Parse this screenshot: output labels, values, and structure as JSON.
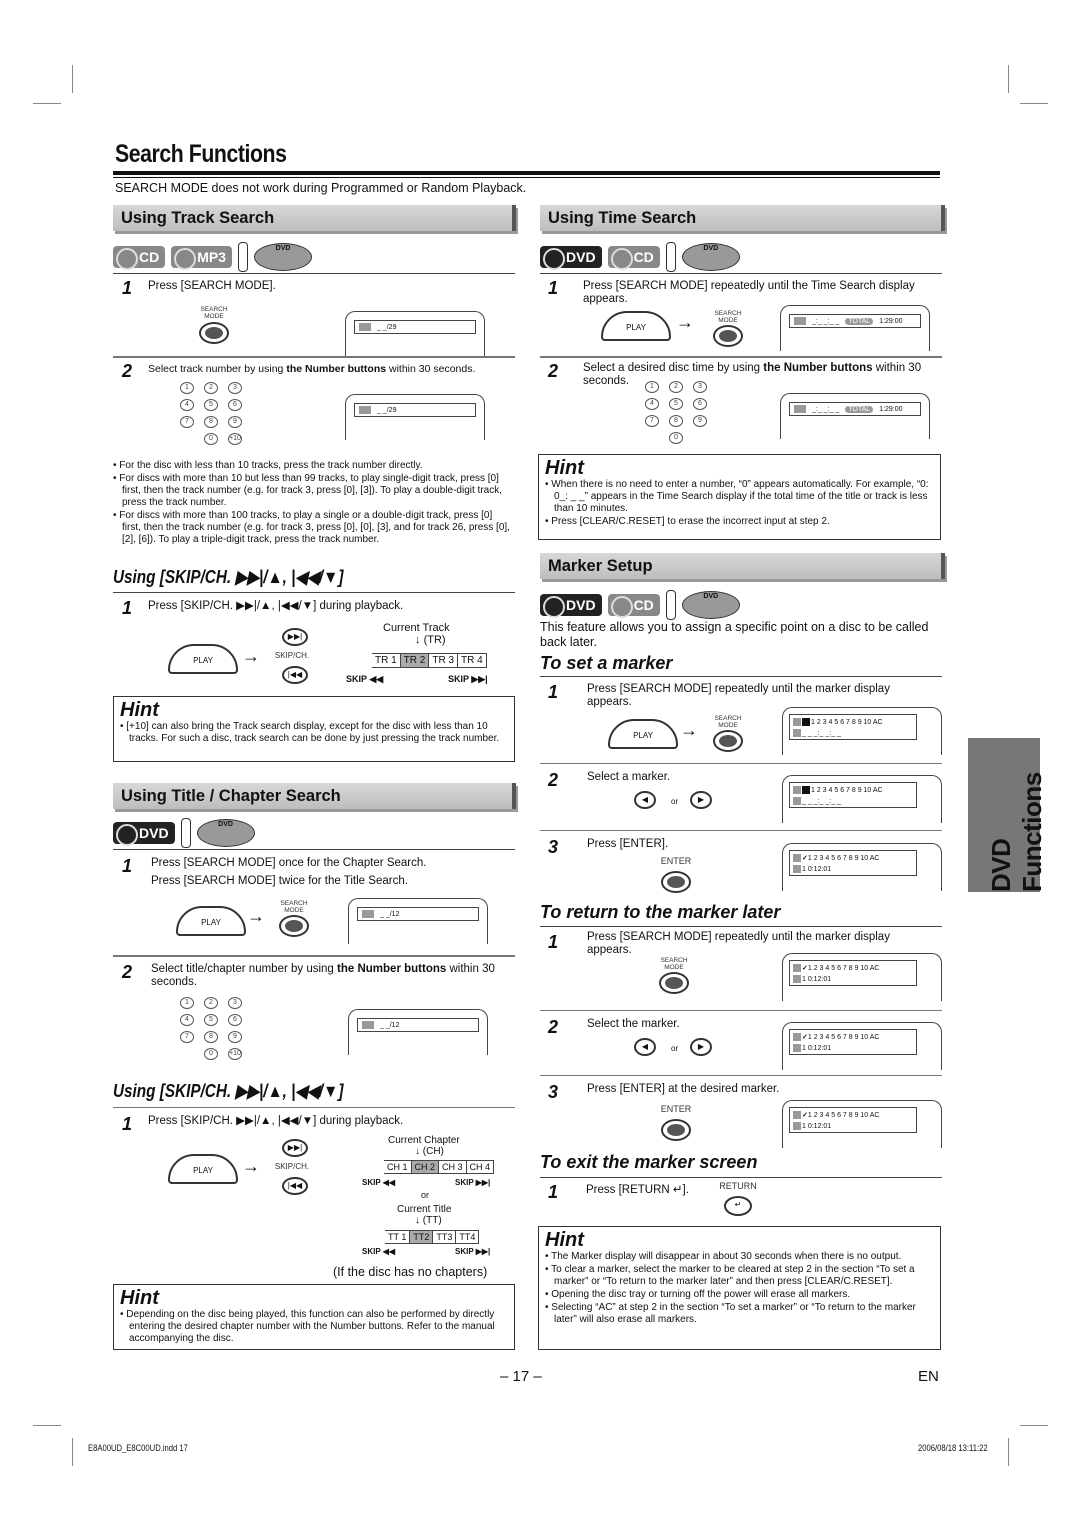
{
  "page": {
    "title": "Search Functions",
    "intro": "SEARCH MODE does not work during Programmed or Random Playback.",
    "page_number": "– 17 –",
    "language": "EN",
    "side_tab": "DVD Functions",
    "footer_file": "E8A00UD_E8C00UD.indd  17",
    "footer_date": "2006/08/18  13:11:22"
  },
  "common": {
    "play": "PLAY",
    "search_mode": "SEARCH MODE",
    "search_mode_l1": "SEARCH",
    "search_mode_l2": "MODE",
    "enter": "ENTER",
    "return": "RETURN",
    "skipch": "SKIP/CH.",
    "skip_prev": "SKIP ◀◀",
    "skip_next": "SKIP ▶▶|",
    "or": "or",
    "hint": "Hint",
    "keys": [
      "1",
      "2",
      "3",
      "4",
      "5",
      "6",
      "7",
      "8",
      "9",
      "0",
      "+10"
    ],
    "keys_time": [
      "1",
      "2",
      "3",
      "4",
      "5",
      "6",
      "7",
      "8",
      "9",
      "0"
    ]
  },
  "track_search": {
    "heading": "Using Track Search",
    "discs": [
      "CD",
      "MP3"
    ],
    "step1": "Press [SEARCH MODE].",
    "step2_pre": "Select track number by using ",
    "step2_bold": "the Number buttons",
    "step2_post": " within 30 seconds.",
    "display": "_ _/29",
    "bullets": [
      "For the disc with less than 10 tracks, press the track number directly.",
      "For discs with more than 10 but less than 99 tracks, to play single-digit track, press [0] first, then the track number (e.g. for track 3, press [0], [3]). To play a double-digit track, press the track number.",
      "For discs with more than 100 tracks, to play a single or a double-digit track, press [0] first, then the track number (e.g. for track 3, press [0], [0], [3], and for track 26, press [0], [2], [6]). To play a triple-digit track, press the track number."
    ]
  },
  "skip_track": {
    "heading": "Using [SKIP/CH. ▶▶|/▲, |◀◀/▼]",
    "step1": "Press [SKIP/CH. ▶▶|/▲, |◀◀/▼] during playback.",
    "current_label": "Current Track",
    "current_abbr": "(TR)",
    "items": [
      "TR 1",
      "TR 2",
      "TR 3",
      "TR 4"
    ],
    "current_index": 1,
    "hint": "[+10] can also bring the Track search display, except for the disc with less than 10 tracks. For such a disc, track search can be done by just pressing the track number."
  },
  "title_chapter": {
    "heading": "Using Title / Chapter Search",
    "discs": [
      "DVD"
    ],
    "step1a": "Press [SEARCH MODE] once for the Chapter Search.",
    "step1b": "Press [SEARCH MODE] twice for the Title Search.",
    "step2_pre": "Select title/chapter number by using ",
    "step2_bold": "the Number buttons",
    "step2_post": " within 30 seconds.",
    "display": "_ _/12"
  },
  "skip_chapter": {
    "heading": "Using [SKIP/CH. ▶▶|/▲, |◀◀/▼]",
    "step1": "Press [SKIP/CH. ▶▶|/▲, |◀◀/▼] during playback.",
    "chapter_label": "Current Chapter",
    "chapter_abbr": "(CH)",
    "chapters": [
      "CH 1",
      "CH 2",
      "CH 3",
      "CH 4"
    ],
    "title_label": "Current Title",
    "title_abbr": "(TT)",
    "titles": [
      "TT 1",
      "TT2",
      "TT3",
      "TT4"
    ],
    "no_chapters": "(If the disc has no chapters)",
    "hint": "Depending on the disc being played, this function can also be performed by directly entering the desired chapter number with the Number buttons. Refer to the manual accompanying the disc."
  },
  "time_search": {
    "heading": "Using Time Search",
    "discs": [
      "DVD",
      "CD"
    ],
    "step1": "Press [SEARCH MODE] repeatedly until the Time Search display appears.",
    "step2_pre": "Select a desired disc time by using ",
    "step2_bold": "the Number buttons",
    "step2_post": " within 30 seconds.",
    "display_time": "_:_ _:_ _",
    "display_total_label": "TOTAL",
    "display_total": "1:29:00",
    "hint_bullets": [
      "When there is no need to enter a number, “0” appears automatically. For example, “0: 0_: _ _” appears in the Time Search display if the total time of the title or track is less than 10 minutes.",
      "Press [CLEAR/C.RESET] to erase the incorrect input at step 2."
    ]
  },
  "marker": {
    "heading": "Marker Setup",
    "discs": [
      "DVD",
      "CD"
    ],
    "intro": "This feature allows you to assign a specific point on a disc to be called back later.",
    "set_heading": "To set a marker",
    "set_steps": [
      "Press [SEARCH MODE] repeatedly until the marker display appears.",
      "Select a marker.",
      "Press [ENTER]."
    ],
    "return_heading": "To return to the marker later",
    "return_steps": [
      "Press [SEARCH MODE] repeatedly until the marker display appears.",
      "Select the marker.",
      "Press [ENTER] at the desired marker."
    ],
    "exit_heading": "To exit the marker screen",
    "exit_step": "Press [RETURN ↵].",
    "marker_slots": "1 2 3 4 5 6 7 8 9 10 AC",
    "blank_time": "_ _  _:_ _:_ _",
    "set_time": "1  0:12:01",
    "hint_bullets": [
      "The Marker display will disappear in about 30 seconds when there is no output.",
      "To clear a marker, select the marker to be cleared at step 2 in the section “To set a marker” or “To return to the marker later” and then press [CLEAR/C.RESET].",
      "Opening the disc tray or turning off the power will erase all markers.",
      "Selecting “AC” at step 2 in the section “To set a marker” or “To return to the marker later” will also erase all markers."
    ]
  }
}
